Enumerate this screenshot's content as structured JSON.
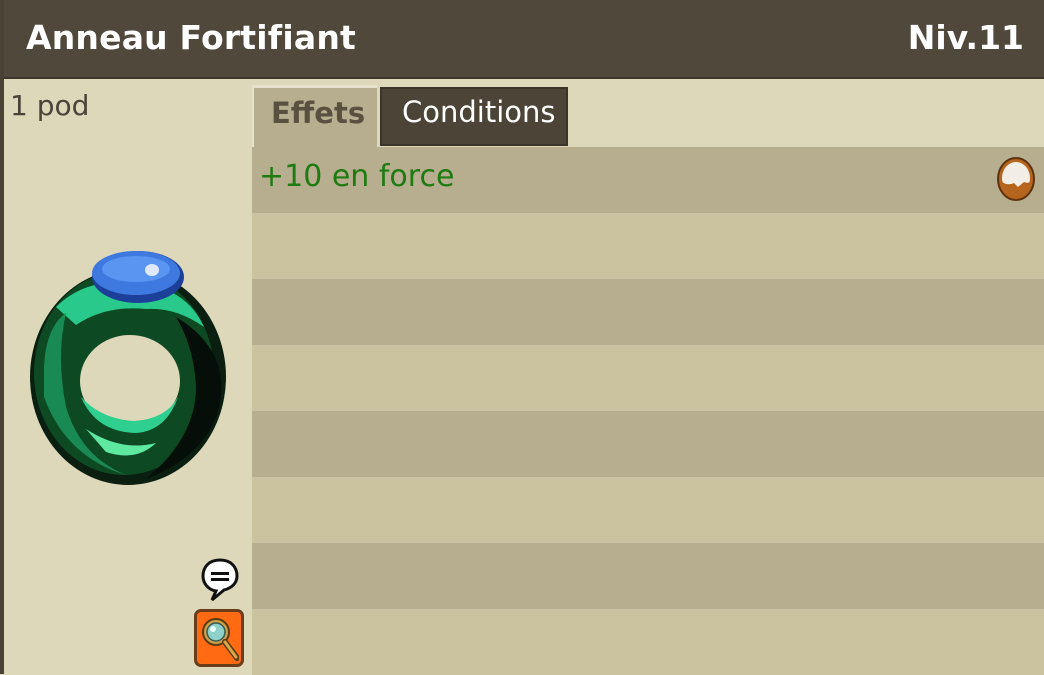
{
  "item": {
    "name": "Anneau Fortifiant",
    "level": "Niv.11",
    "weight": "1 pod"
  },
  "tabs": [
    {
      "label": "Effets",
      "active": true
    },
    {
      "label": "Conditions",
      "active": false
    }
  ],
  "effects": [
    {
      "text": "+10 en force",
      "icon": "earth-element-icon",
      "color": "#1f7a12"
    }
  ],
  "colors": {
    "titlebar": "#51483c",
    "accent_orange": "#ff6a12",
    "row_dark": "#b7ae8f",
    "row_light": "#cbc29f"
  }
}
